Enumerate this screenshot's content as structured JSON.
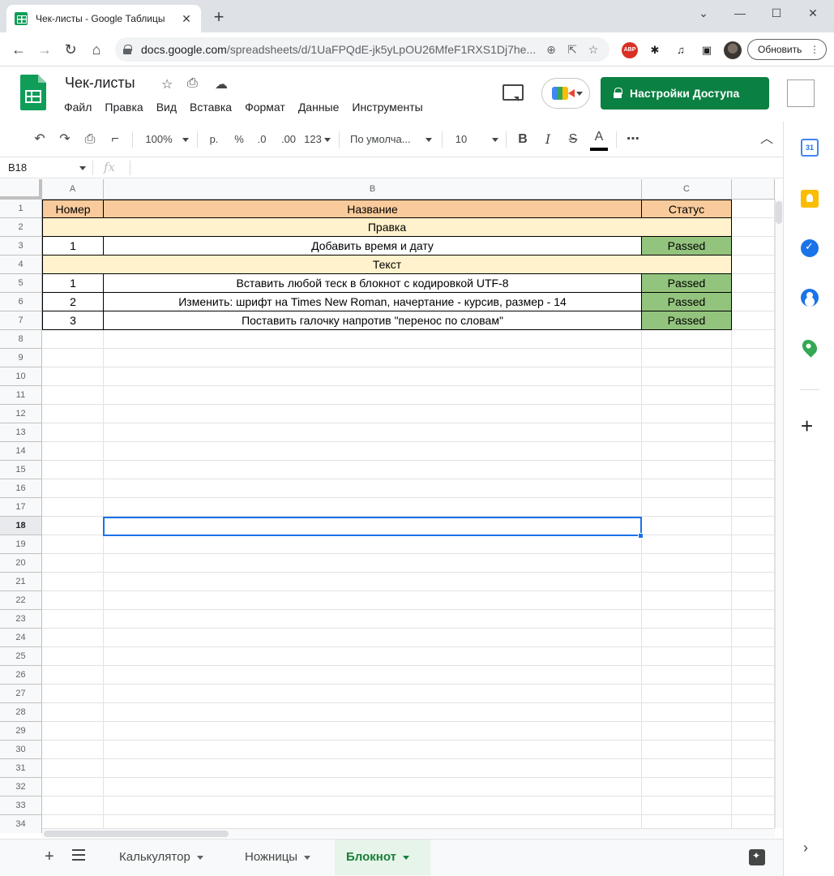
{
  "browser": {
    "tab_title": "Чек-листы - Google Таблицы",
    "url_domain": "docs.google.com",
    "url_path": "/spreadsheets/d/1UaFPQdE-jk5yLpOU26MfeF1RXS1Dj7he...",
    "update_label": "Обновить",
    "abp_label": "ABP"
  },
  "doc": {
    "title": "Чек-листы",
    "menu": [
      "Файл",
      "Правка",
      "Вид",
      "Вставка",
      "Формат",
      "Данные",
      "Инструменты"
    ],
    "share_label": "Настройки Доступа"
  },
  "toolbar": {
    "zoom": "100%",
    "currency": "р.",
    "percent": "%",
    "dec_decrease": ".0",
    "dec_increase": ".00",
    "format_more": "123",
    "font": "По умолча...",
    "font_size": "10",
    "bold": "B",
    "italic": "I",
    "strike": "S",
    "text_color": "A",
    "more": "⋯"
  },
  "formula_bar": {
    "name_box": "B18",
    "fx": "fx",
    "value": ""
  },
  "grid": {
    "columns": [
      "A",
      "B",
      "C"
    ],
    "row_numbers": [
      "1",
      "2",
      "3",
      "4",
      "5",
      "6",
      "7",
      "8",
      "9",
      "10",
      "11",
      "12",
      "13",
      "14",
      "15",
      "16",
      "17",
      "18",
      "19",
      "20",
      "21",
      "22",
      "23",
      "24",
      "25",
      "26",
      "27",
      "28",
      "29",
      "30",
      "31",
      "32",
      "33",
      "34"
    ],
    "selected_row": "18",
    "header": [
      "Номер",
      "Название",
      "Статус"
    ],
    "sections": [
      {
        "title": "Правка",
        "rows": [
          {
            "num": "1",
            "name": "Добавить время и дату",
            "status": "Passed"
          }
        ]
      },
      {
        "title": "Текст",
        "rows": [
          {
            "num": "1",
            "name": "Вставить любой теск в блокнот с кодировкой UTF-8",
            "status": "Passed"
          },
          {
            "num": "2",
            "name": "Изменить: шрифт на Times New Roman, начертание - курсив, размер - 14",
            "status": "Passed"
          },
          {
            "num": "3",
            "name": "Поставить галочку напротив \"перенос по словам\"",
            "status": "Passed"
          }
        ]
      }
    ]
  },
  "sheets": {
    "tabs": [
      "Калькулятор",
      "Ножницы",
      "Блокнот"
    ],
    "active": "Блокнот"
  },
  "side_panel": {
    "calendar_day": "31"
  },
  "colors": {
    "header_fill": "#f9cb9c",
    "section_fill": "#fff2cc",
    "passed_fill": "#93c47d",
    "share_button": "#0b8043",
    "selection": "#1a73e8"
  }
}
